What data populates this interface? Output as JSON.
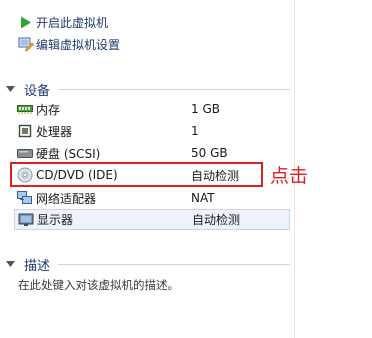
{
  "actions": {
    "power_on": "开启此虚拟机",
    "edit_settings": "编辑虚拟机设置"
  },
  "devices_section": {
    "title": "设备",
    "items": [
      {
        "name": "内存",
        "value": "1 GB",
        "icon": "memory-icon"
      },
      {
        "name": "处理器",
        "value": "1",
        "icon": "processor-icon"
      },
      {
        "name": "硬盘 (SCSI)",
        "value": "50 GB",
        "icon": "hard-disk-icon"
      },
      {
        "name": "CD/DVD (IDE)",
        "value": "自动检测",
        "icon": "cd-dvd-icon"
      },
      {
        "name": "网络适配器",
        "value": "NAT",
        "icon": "network-adapter-icon"
      },
      {
        "name": "显示器",
        "value": "自动检测",
        "icon": "display-icon"
      }
    ]
  },
  "annotation": {
    "text": "点击",
    "color": "#e02020"
  },
  "description_section": {
    "title": "描述",
    "placeholder": "在此处键入对该虚拟机的描述。"
  },
  "colors": {
    "link_text": "#1e3b6f",
    "section_rule": "#c9d6ea",
    "selected_row_bg": "#eef3fb",
    "power_green": "#2fa52f"
  }
}
